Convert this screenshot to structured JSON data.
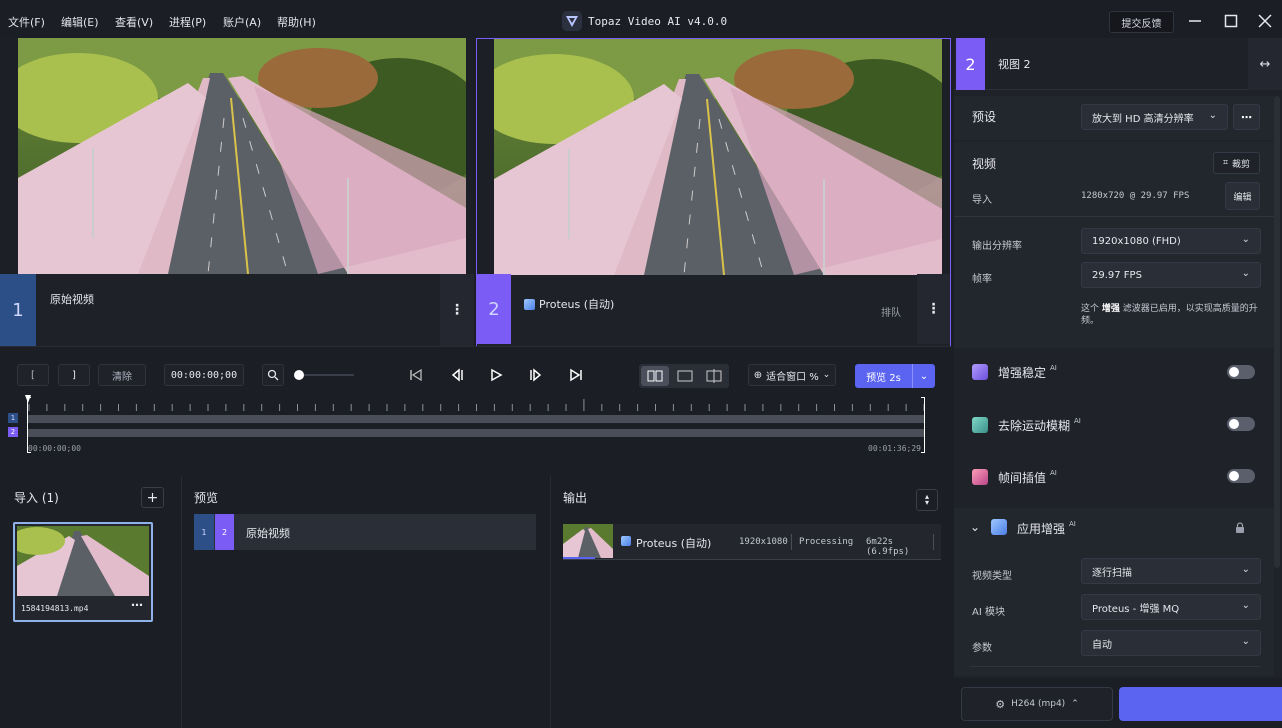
{
  "menu": [
    "文件(F)",
    "编辑(E)",
    "查看(V)",
    "进程(P)",
    "账户(A)",
    "帮助(H)"
  ],
  "app_title": "Topaz Video AI  v4.0.0",
  "feedback_label": "提交反馈",
  "panes": [
    {
      "number": "1",
      "label": "原始视频"
    },
    {
      "number": "2",
      "label": "Proteus (自动)",
      "status": "排队"
    }
  ],
  "transport": {
    "in_label": "[",
    "out_label": "]",
    "clear_label": "清除",
    "timecode": "00:00:00;00",
    "fit_label": "适合窗口 %",
    "preview_label": "预览 2s",
    "time_start": "00:00:00;00",
    "time_end": "00:01:36;29",
    "track1": "1",
    "track2": "2"
  },
  "import_panel": {
    "title": "导入 (1)",
    "file_name": "1584194813.mp4"
  },
  "preview_panel": {
    "title": "预览",
    "row_num1": "1",
    "row_num2": "2",
    "row_label": "原始视频"
  },
  "output_panel": {
    "title": "输出",
    "model": "Proteus (自动)",
    "resolution": "1920x1080",
    "status": "Processing",
    "eta": "6m22s (6.9fps)"
  },
  "sidebar": {
    "view_num": "2",
    "view_label": "视图 2",
    "preset_label": "预设",
    "preset_value": "放大到 HD 高清分辨率",
    "video_label": "视频",
    "crop_label": "裁剪",
    "import_label": "导入",
    "import_value": "1280x720 @ 29.97 FPS",
    "edit_label": "编辑",
    "out_res_label": "输出分辨率",
    "out_res_value": "1920x1080 (FHD)",
    "fps_label": "帧率",
    "fps_value": "29.97 FPS",
    "note_prefix": "这个 ",
    "note_bold": "增强",
    "note_suffix": " 滤波器已启用，以实现高质量的升频。",
    "features": [
      {
        "label": "增强稳定",
        "ai": "AI",
        "color": "#8b6cf0"
      },
      {
        "label": "去除运动模糊",
        "ai": "AI",
        "color": "#5fb0a8"
      },
      {
        "label": "帧间插值",
        "ai": "AI",
        "color": "#c75a8c"
      }
    ],
    "enhance_label": "应用增强",
    "enhance_ai": "AI",
    "video_type_label": "视频类型",
    "video_type_value": "逐行扫描",
    "ai_model_label": "AI 模块",
    "ai_model_value": "Proteus - 增强 MQ",
    "param_label": "参数",
    "param_value": "自动",
    "codec_label": "H264 (mp4)"
  },
  "colors": {
    "accent": "#7b5cf5",
    "pane1": "#2b4f86",
    "export": "#5b64f0"
  }
}
